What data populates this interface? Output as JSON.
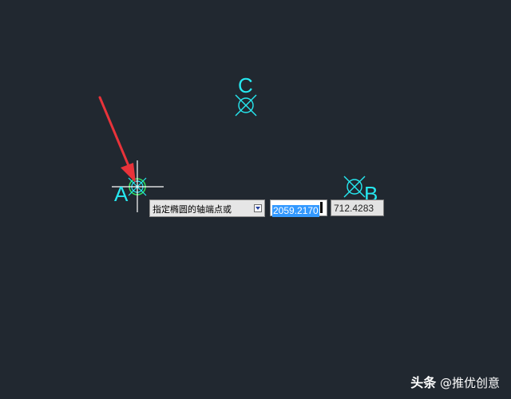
{
  "points": {
    "A": {
      "label": "A"
    },
    "B": {
      "label": "B"
    },
    "C": {
      "label": "C"
    }
  },
  "input_prompt": {
    "text": "指定椭圆的轴端点或",
    "dropdown_icon": "down-arrow-icon"
  },
  "coordinate_input": {
    "x_value": "2059.2170",
    "y_value": "712.4283"
  },
  "watermark": {
    "brand": "头条",
    "author": "@推优创意"
  },
  "colors": {
    "background": "#212830",
    "point_marker": "#26E8F0",
    "snap_marker": "#2EDB5A",
    "arrow": "#E8333A",
    "crosshair": "#FFFFFF",
    "selection": "#3399FF"
  }
}
